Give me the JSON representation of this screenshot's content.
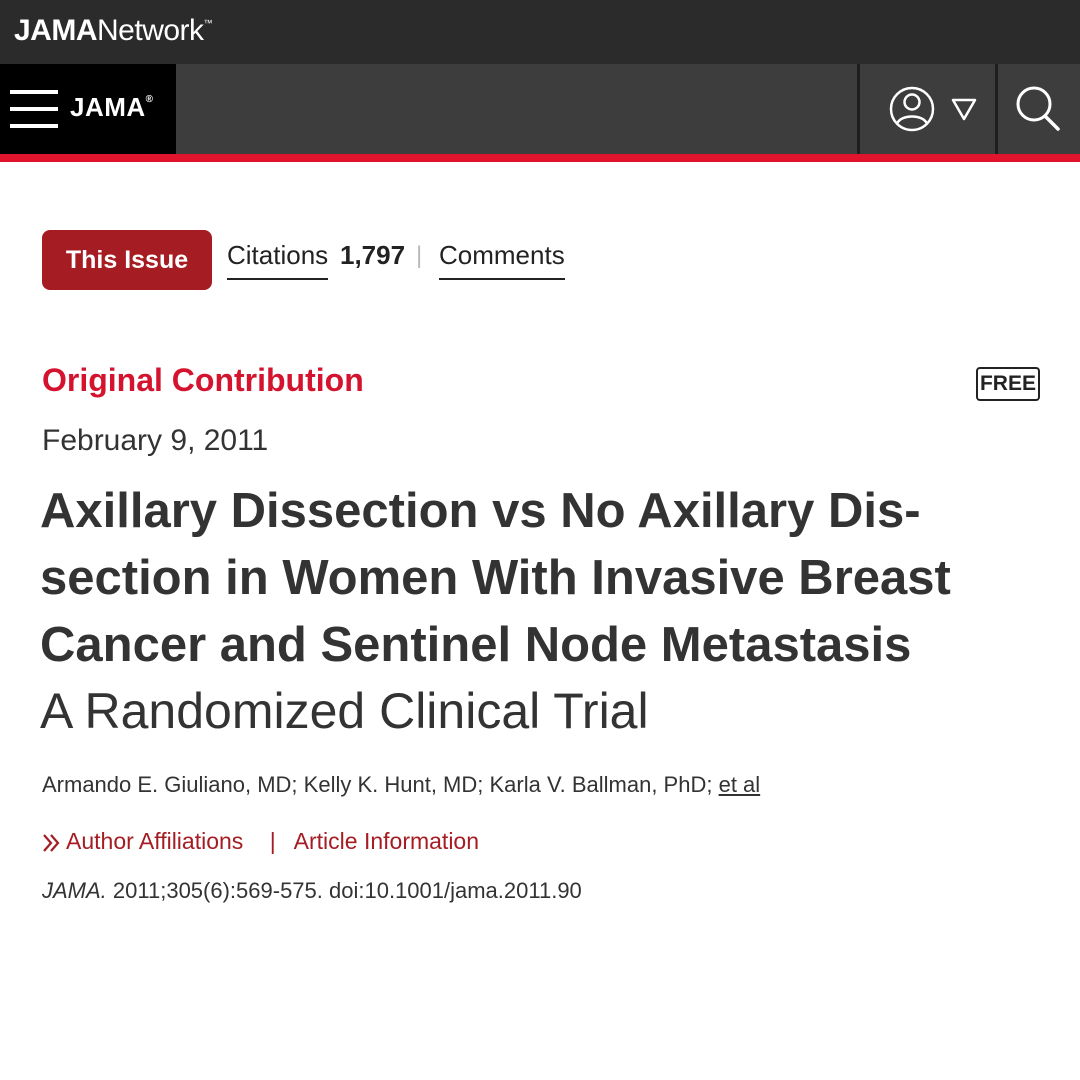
{
  "network": {
    "brand_bold": "JAMA",
    "brand_light": "Network",
    "trademark": "™"
  },
  "header": {
    "journal": "JAMA",
    "registered": "®"
  },
  "toolbar": {
    "this_issue": "This Issue",
    "citations_label": "Citations",
    "citations_count": "1,797",
    "separator": "|",
    "comments": "Comments"
  },
  "article": {
    "type": "Original Contribution",
    "free_badge": "FREE",
    "date": "February 9, 2011",
    "title_line1": "Axillary Dissection vs No Axillary Dis-",
    "title_line2": "section in Women With Invasive Breast",
    "title_line3": "Cancer and Sentinel Node Metastasis",
    "subtitle": "A Randomized Clinical Trial",
    "authors": "Armando E. Giuliano, MD; Kelly K. Hunt, MD; Karla V. Ballman, PhD; ",
    "et_al": "et al",
    "affiliations_link": "Author Affiliations",
    "links_separator": "|",
    "article_info_link": "Article Information",
    "citation_journal": "JAMA.",
    "citation_details": " 2011;305(6):569-575. doi:10.1001/jama.2011.90"
  },
  "colors": {
    "network_bar": "#2b2b2b",
    "journal_bar": "#3d3d3d",
    "accent_red": "#e0152d",
    "button_red": "#a51c22"
  },
  "icons": [
    "menu-icon",
    "user-icon",
    "dropdown-triangle-icon",
    "search-icon",
    "chevron-double-right-icon"
  ]
}
